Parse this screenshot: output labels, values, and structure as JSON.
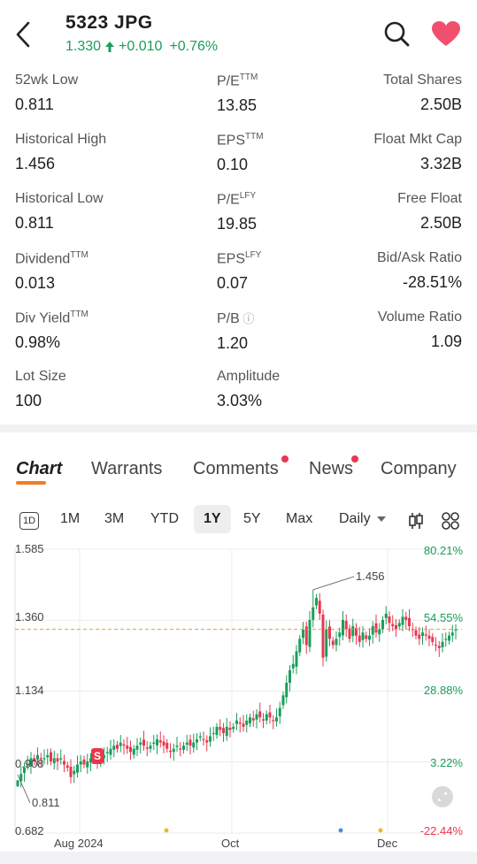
{
  "header": {
    "ticker": "5323  JPG",
    "price": "1.330",
    "change": "+0.010",
    "change_pct": "+0.76%",
    "up_color": "#1a9e5c"
  },
  "stats": [
    {
      "label": "52wk Low",
      "sup": "",
      "value": "0.811"
    },
    {
      "label": "P/E",
      "sup": "TTM",
      "value": "13.85"
    },
    {
      "label": "Total Shares",
      "sup": "",
      "value": "2.50B"
    },
    {
      "label": "Historical High",
      "sup": "",
      "value": "1.456"
    },
    {
      "label": "EPS",
      "sup": "TTM",
      "value": "0.10"
    },
    {
      "label": "Float Mkt Cap",
      "sup": "",
      "value": "3.32B"
    },
    {
      "label": "Historical Low",
      "sup": "",
      "value": "0.811"
    },
    {
      "label": "P/E",
      "sup": "LFY",
      "value": "19.85"
    },
    {
      "label": "Free Float",
      "sup": "",
      "value": "2.50B"
    },
    {
      "label": "Dividend",
      "sup": "TTM",
      "value": "0.013"
    },
    {
      "label": "EPS",
      "sup": "LFY",
      "value": "0.07"
    },
    {
      "label": "Bid/Ask Ratio",
      "sup": "",
      "value": "-28.51%"
    },
    {
      "label": "Div Yield",
      "sup": "TTM",
      "value": "0.98%"
    },
    {
      "label": "P/B",
      "sup": "",
      "value": "1.20"
    },
    {
      "label": "Volume Ratio",
      "sup": "",
      "value": "1.09"
    },
    {
      "label": "Lot Size",
      "sup": "",
      "value": "100"
    },
    {
      "label": "Amplitude",
      "sup": "",
      "value": "3.03%"
    }
  ],
  "tabs": [
    "Chart",
    "Warrants",
    "Comments",
    "News",
    "Company"
  ],
  "periods": {
    "badge": "1D",
    "items": [
      "1M",
      "3M",
      "YTD",
      "1Y",
      "5Y",
      "Max"
    ],
    "selected": "1Y",
    "interval": "Daily"
  },
  "chart_data": {
    "type": "candlestick",
    "ylim": [
      0.682,
      1.585
    ],
    "y_ticks": [
      "1.585",
      "1.360",
      "1.134",
      "0.908",
      "0.682"
    ],
    "pct_ticks": [
      "80.21%",
      "54.55%",
      "28.88%",
      "3.22%",
      "-22.44%"
    ],
    "x_ticks": [
      "Aug 2024",
      "Oct",
      "Dec"
    ],
    "high_label": "1.456",
    "low_label": "0.811",
    "last_close": 1.33,
    "marker": "S",
    "up_color": "#1a9e5c",
    "down_color": "#e8384f",
    "closes": [
      0.85,
      0.87,
      0.89,
      0.9,
      0.92,
      0.91,
      0.93,
      0.92,
      0.92,
      0.93,
      0.91,
      0.92,
      0.91,
      0.92,
      0.9,
      0.89,
      0.86,
      0.88,
      0.9,
      0.91,
      0.9,
      0.91,
      0.92,
      0.92,
      0.91,
      0.92,
      0.93,
      0.94,
      0.95,
      0.96,
      0.95,
      0.97,
      0.96,
      0.95,
      0.94,
      0.95,
      0.96,
      0.97,
      0.96,
      0.95,
      0.96,
      0.97,
      0.98,
      0.97,
      0.96,
      0.95,
      0.94,
      0.95,
      0.96,
      0.95,
      0.96,
      0.97,
      0.96,
      0.97,
      0.98,
      0.99,
      0.98,
      0.97,
      0.99,
      1.0,
      1.02,
      1.01,
      1.0,
      1.02,
      1.01,
      1.02,
      1.04,
      1.03,
      1.02,
      1.04,
      1.05,
      1.04,
      1.06,
      1.05,
      1.04,
      1.06,
      1.05,
      1.04,
      1.05,
      1.08,
      1.12,
      1.16,
      1.2,
      1.22,
      1.26,
      1.3,
      1.33,
      1.28,
      1.36,
      1.4,
      1.43,
      1.38,
      1.24,
      1.33,
      1.3,
      1.28,
      1.3,
      1.32,
      1.36,
      1.33,
      1.3,
      1.34,
      1.31,
      1.29,
      1.32,
      1.3,
      1.31,
      1.34,
      1.32,
      1.33,
      1.36,
      1.38,
      1.35,
      1.34,
      1.33,
      1.35,
      1.37,
      1.36,
      1.34,
      1.33,
      1.31,
      1.3,
      1.32,
      1.31,
      1.3,
      1.29,
      1.28,
      1.27,
      1.29,
      1.3,
      1.31,
      1.32,
      1.33
    ]
  }
}
